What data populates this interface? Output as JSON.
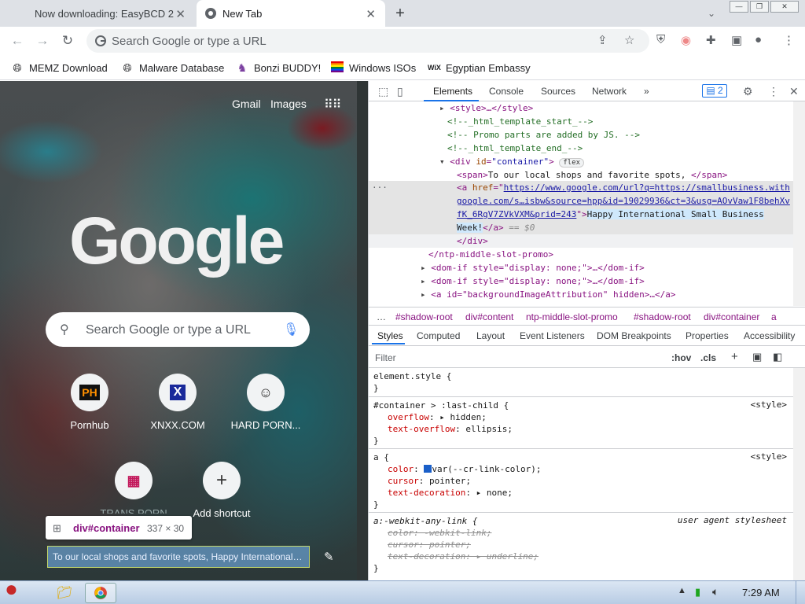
{
  "tabs": [
    {
      "title": "Now downloading: EasyBCD 2"
    },
    {
      "title": "New Tab"
    }
  ],
  "omnibox": {
    "placeholder": "Search Google or type a URL"
  },
  "bookmarks": [
    {
      "label": "MEMZ Download",
      "icon": "globe-icon"
    },
    {
      "label": "Malware Database",
      "icon": "globe-icon"
    },
    {
      "label": "Bonzi BUDDY!",
      "icon": "bonzi-icon"
    },
    {
      "label": "Windows ISOs",
      "icon": "rainbow-flag-icon"
    },
    {
      "label": "Egyptian Embassy",
      "icon": "wix-icon"
    }
  ],
  "ntp": {
    "gmail": "Gmail",
    "images": "Images",
    "logo": "Google",
    "search_placeholder": "Search Google or type a URL",
    "shortcuts": [
      {
        "label": "Pornhub",
        "glyph": "PH"
      },
      {
        "label": "XNXX.COM",
        "glyph": "X"
      },
      {
        "label": "HARD PORN...",
        "glyph": "☺"
      },
      {
        "label": "TRANS PORN",
        "glyph": "▦"
      },
      {
        "label": "Add shortcut",
        "glyph": "+"
      }
    ],
    "tooltip_name": "div#container",
    "tooltip_size": "337 × 30",
    "promo_text": "To our local shops and favorite spots, Happy International Small Business Week!"
  },
  "devtools": {
    "tabs": [
      "Elements",
      "Console",
      "Sources",
      "Network"
    ],
    "issues_badge": "2",
    "dom": {
      "l1": "<style>…</style>",
      "l2": "<!--_html_template_start_-->",
      "l3": "<!-- Promo parts are added by JS. -->",
      "l4": "<!--_html_template_end_-->",
      "l5a": "<div ",
      "l5b": "id",
      "l5c": "\"container\"",
      "l5d": ">",
      "l5e": "flex",
      "l6a": "<span>",
      "l6b": "To our local shops and favorite spots, ",
      "l6c": "</span>",
      "l7a": "<a ",
      "l7b": "href",
      "l7c": "https://www.google.com/url?q=https://smallbusiness.with",
      "l8": "google.com/s…isbw&source=hpp&id=19029936&ct=3&usg=AOvVaw1F8behXv",
      "l9a": "fK_6RgV7ZVkVXM&prid=243",
      "l9b": "\">",
      "l9c": "Happy International Small Business",
      "l10a": "Week!",
      "l10b": "</a>",
      "l10c": "== $0",
      "l11": "</div>",
      "l12": "</ntp-middle-slot-promo>",
      "l13": "<dom-if style=\"display: none;\">…</dom-if>",
      "l14": "<dom-if style=\"display: none;\">…</dom-if>",
      "l15": "<a id=\"backgroundImageAttribution\" hidden>…</a>"
    },
    "breadcrumbs": [
      "…",
      "#shadow-root",
      "div#content",
      "ntp-middle-slot-promo",
      "#shadow-root",
      "div#container",
      "a"
    ],
    "style_tabs": [
      "Styles",
      "Computed",
      "Layout",
      "Event Listeners",
      "DOM Breakpoints",
      "Properties",
      "Accessibility"
    ],
    "filter_placeholder": "Filter",
    "hov": ":hov",
    "cls": ".cls",
    "rules": {
      "r1": "element.style {",
      "r1e": "}",
      "r2": "#container > :last-child {",
      "r2src": "<style>",
      "r2p1": "overflow",
      "r2v1": "hidden;",
      "r2p2": "text-overflow",
      "r2v2": "ellipsis;",
      "r2e": "}",
      "r3": "a {",
      "r3src": "<style>",
      "r3p1": "color",
      "r3v1": "var(--cr-link-color);",
      "r3p2": "cursor",
      "r3v2": "pointer;",
      "r3p3": "text-decoration",
      "r3v3": "none;",
      "r3e": "}",
      "r4": "a:-webkit-any-link {",
      "r4src": "user agent stylesheet",
      "r4l1": "color: -webkit-link;",
      "r4l2": "cursor: pointer;",
      "r4l3": "text-decoration: ▸ underline;",
      "r4e": "}"
    }
  },
  "taskbar": {
    "clock": "7:29 AM"
  }
}
